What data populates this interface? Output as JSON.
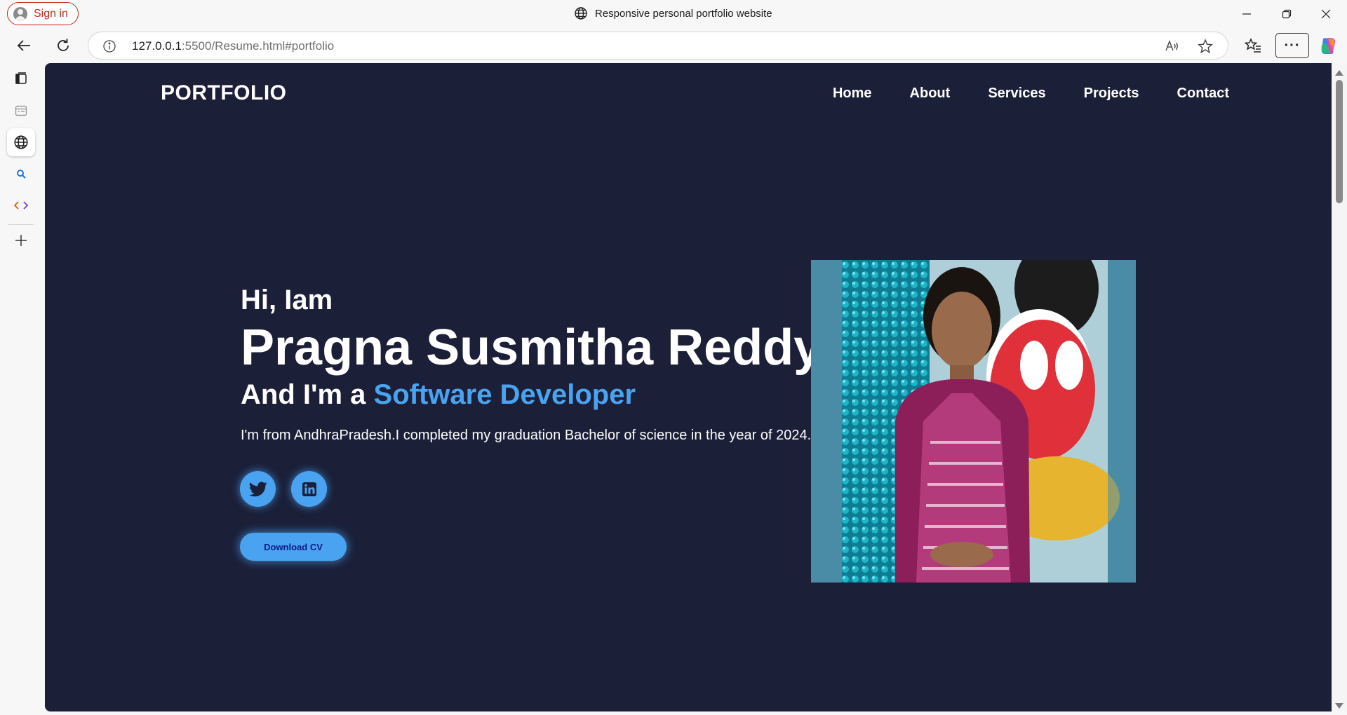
{
  "browser": {
    "sign_in_label": "Sign in",
    "tab_title": "Responsive personal portfolio website",
    "url_host": "127.0.0.1",
    "url_rest": ":5500/Resume.html#portfolio",
    "more_label": "···"
  },
  "nav": {
    "logo": "PORTFOLIO",
    "links": [
      "Home",
      "About",
      "Services",
      "Projects",
      "Contact"
    ]
  },
  "hero": {
    "greeting": "Hi, Iam",
    "name": "Pragna Susmitha Reddy",
    "role_prefix": "And I'm a",
    "role_highlight": "Software Developer",
    "bio": "I'm from AndhraPradesh.I completed my graduation Bachelor of science in the year of 2024.",
    "socials": [
      "twitter-icon",
      "linkedin-icon"
    ],
    "cv_button": "Download CV"
  },
  "colors": {
    "page_background": "#1b1f38",
    "accent": "#4aa3f0",
    "sign_in_red": "#c42b1c"
  }
}
